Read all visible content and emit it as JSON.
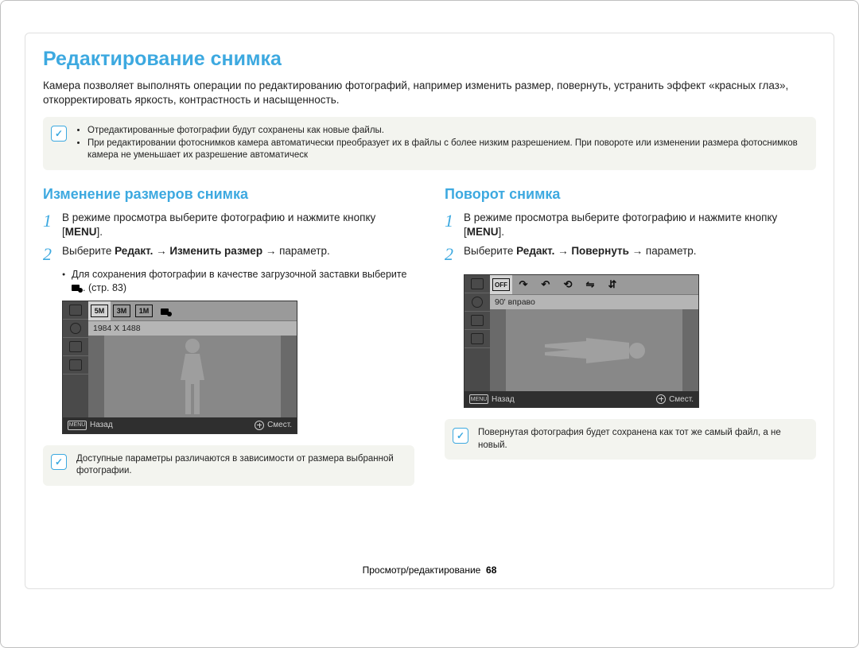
{
  "title": "Редактирование снимка",
  "intro": "Камера позволяет выполнять операции по редактированию фотографий, например изменить размер, повернуть, устранить эффект «красных глаз», откорректировать яркость, контрастность и насыщенность.",
  "top_note": {
    "icon": "note-icon",
    "items": [
      "Отредактированные фотографии будут сохранены как новые файлы.",
      "При редактировании фотоснимков камера автоматически преобразует их в файлы с более низким разрешением. При повороте или изменении размера фотоснимков камера не уменьшает их разрешение автоматическ"
    ]
  },
  "left": {
    "heading": "Изменение размеров снимка",
    "step1_a": "В режиме просмотра выберите фотографию и нажмите кнопку [",
    "step1_b": "MENU",
    "step1_c": "].",
    "step2_a": "Выберите ",
    "step2_b": "Редакт.",
    "step2_c": " → ",
    "step2_d": "Изменить размер",
    "step2_e": " → параметр.",
    "sub_a": "Для сохранения фотографии в качестве загрузочной заставки выберите ",
    "sub_b": ". (стр. 83)",
    "cam": {
      "top_icons": [
        "5M",
        "3M",
        "1M"
      ],
      "status": "1984 X 1488",
      "footer_back_label": "MENU",
      "footer_back": "Назад",
      "footer_move": "Смест."
    },
    "note": "Доступные параметры различаются в зависимости от размера выбранной фотографии."
  },
  "right": {
    "heading": "Поворот снимка",
    "step1_a": "В режиме просмотра выберите фотографию и нажмите кнопку [",
    "step1_b": "MENU",
    "step1_c": "].",
    "step2_a": "Выберите ",
    "step2_b": "Редакт.",
    "step2_c": " → ",
    "step2_d": "Повернуть",
    "step2_e": " → параметр.",
    "cam": {
      "status": "90' вправо",
      "footer_back_label": "MENU",
      "footer_back": "Назад",
      "footer_move": "Смест."
    },
    "note": "Повернутая фотография будет сохранена как тот же самый файл, а не новый."
  },
  "footer": {
    "section": "Просмотр/редактирование",
    "page": "68"
  }
}
